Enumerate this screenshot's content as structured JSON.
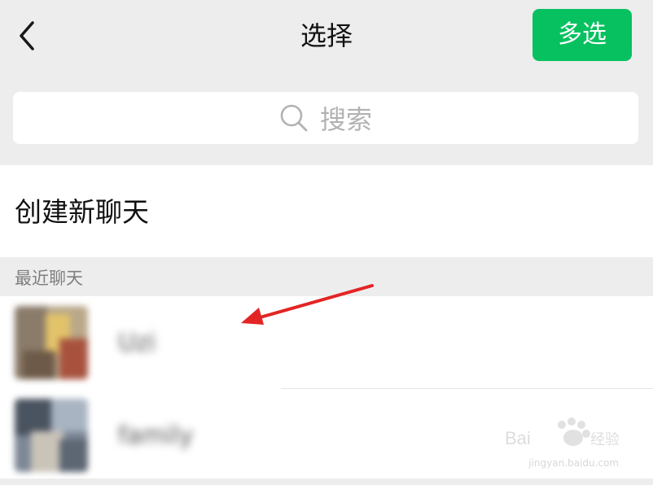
{
  "header": {
    "title": "选择",
    "multi_select_label": "多选"
  },
  "search": {
    "placeholder": "搜索"
  },
  "create_chat": {
    "label": "创建新聊天"
  },
  "recent": {
    "section_label": "最近聊天",
    "items": [
      {
        "name": "Uzi"
      },
      {
        "name": "family"
      }
    ]
  },
  "watermark": {
    "brand": "Baidu 经验",
    "url": "jingyan.baidu.com"
  },
  "annotation": {
    "arrow_color": "#e32424"
  },
  "colors": {
    "accent": "#07c160",
    "background": "#ededed"
  }
}
